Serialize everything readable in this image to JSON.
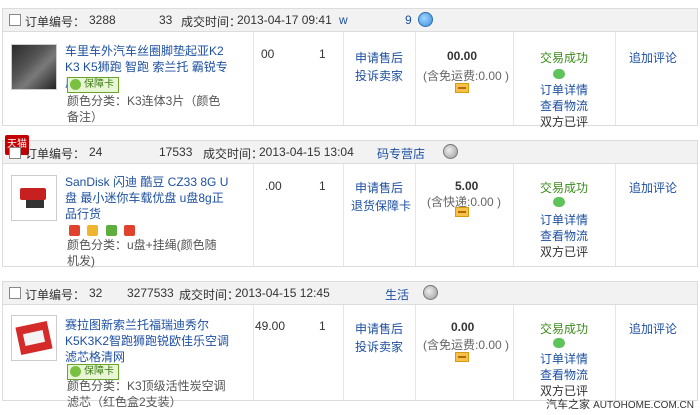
{
  "labels": {
    "order_no": "订单编号：",
    "trade_time": "成交时间：",
    "apply_after_sale": "申请售后",
    "complain_seller": "投诉卖家",
    "refund_guarantee": "退货保障卡",
    "trade_success": "交易成功",
    "order_detail": "订单详情",
    "view_logistics": "查看物流",
    "both_rated": "双方已评",
    "add_review": "追加评论",
    "guarantee_card": "保障卡"
  },
  "orders": [
    {
      "order_no_left": "3288",
      "order_no_right": "33",
      "trade_time": "2013-04-17 09:41",
      "shop_name_left": "w",
      "shop_name_right": "9",
      "title": "车里车外汽车丝圈脚垫起亚K2 K3 K5狮跑 智跑 索兰托 霸锐专用",
      "attr": "颜色分类：K3连体3片（颜色备注）",
      "unit_price": "00",
      "quantity": "1",
      "total": "00.00",
      "shipping": "(含免运费:0.00 )"
    },
    {
      "order_no_left": "24",
      "order_no_right": "17533",
      "trade_time": "2013-04-15 13:04",
      "shop_name": "码专营店",
      "tmall_badge": "天猫",
      "title": "SanDisk 闪迪 酷豆 CZ33 8G U盘 最小迷你车载优盘 u盘8g正品行货",
      "attr": "颜色分类：u盘+挂绳(颜色随机发)",
      "unit_price": ".00",
      "quantity": "1",
      "total": "5.00",
      "shipping": "(含快递:0.00 )"
    },
    {
      "order_no_left": "32",
      "order_no_right": "3277533",
      "trade_time": "2013-04-15 12:45",
      "shop_name": "生活",
      "title": "赛拉图新索兰托福瑞迪秀尔 K5K3K2智跑狮跑锐欧佳乐空调滤芯格清网",
      "attr": "颜色分类：K3顶级活性炭空调滤芯（红色盒2支装）",
      "unit_price": "49.00",
      "quantity": "1",
      "total": "0.00",
      "shipping": "(含免运费:0.00 )"
    }
  ],
  "footer": {
    "site": "汽车之家",
    "domain": "AUTOHOME.COM.CN"
  },
  "colors": {
    "link": "#1e50a2",
    "success": "#3b8b1a",
    "header_bg": "#f2f2f2"
  },
  "icons": [
    "checkbox-icon",
    "wangwang-icon",
    "tmall-icon",
    "guarantee-icon",
    "chat-icon",
    "payment-icon",
    "gift-icon"
  ]
}
